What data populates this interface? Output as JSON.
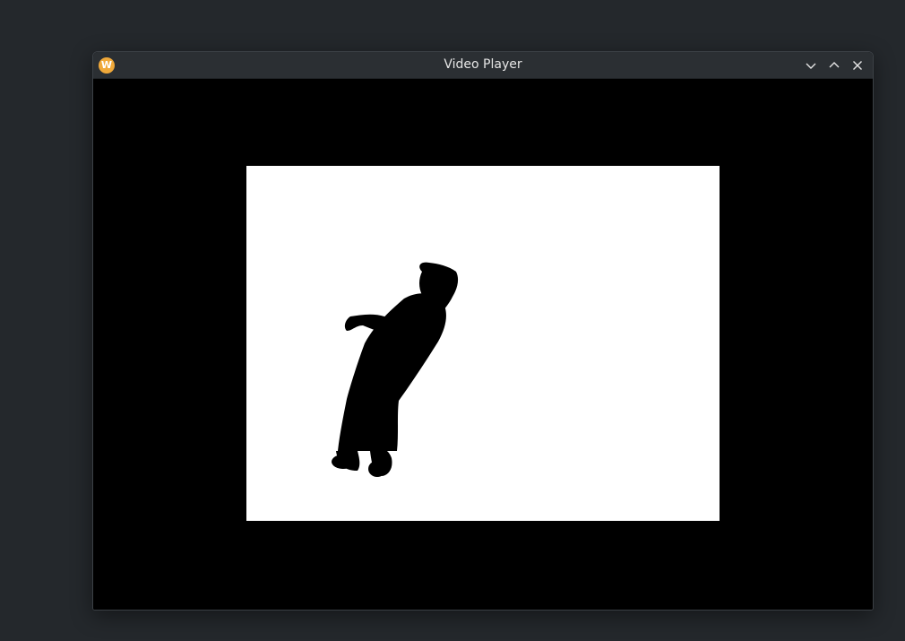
{
  "window": {
    "title": "Video Player",
    "app_icon_letter": "W",
    "controls": [
      "minimize",
      "maximize",
      "close"
    ]
  },
  "colors": {
    "desktop": "#24282c",
    "titlebar": "#2b2f33",
    "title_text": "#e6e6e6",
    "app_icon": "#f0a93a",
    "video_background": "#000000",
    "video_frame": "#ffffff",
    "silhouette": "#000000"
  },
  "icons": {
    "app": "app-logo-icon",
    "minimize": "chevron-down-icon",
    "maximize": "chevron-up-icon",
    "close": "close-icon"
  }
}
